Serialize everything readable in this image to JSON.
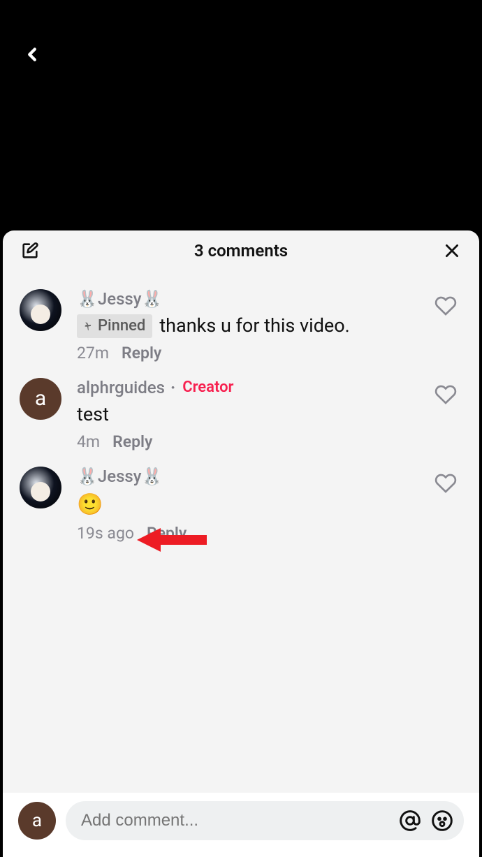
{
  "header": {
    "title": "3 comments"
  },
  "comments": [
    {
      "username": "🐰Jessy🐰",
      "pinned_label": "Pinned",
      "text": "thanks u for this video.",
      "time": "27m",
      "reply_label": "Reply",
      "creator": false
    },
    {
      "username": "alphrguides",
      "creator_label": "Creator",
      "text": "test",
      "time": "4m",
      "reply_label": "Reply",
      "creator": true
    },
    {
      "username": "🐰Jessy🐰",
      "text": "🙂",
      "time": "19s ago",
      "reply_label": "Reply",
      "creator": false
    }
  ],
  "input": {
    "placeholder": "Add comment...",
    "avatar_letter": "a"
  },
  "avatar_letters": {
    "alphr": "a"
  }
}
